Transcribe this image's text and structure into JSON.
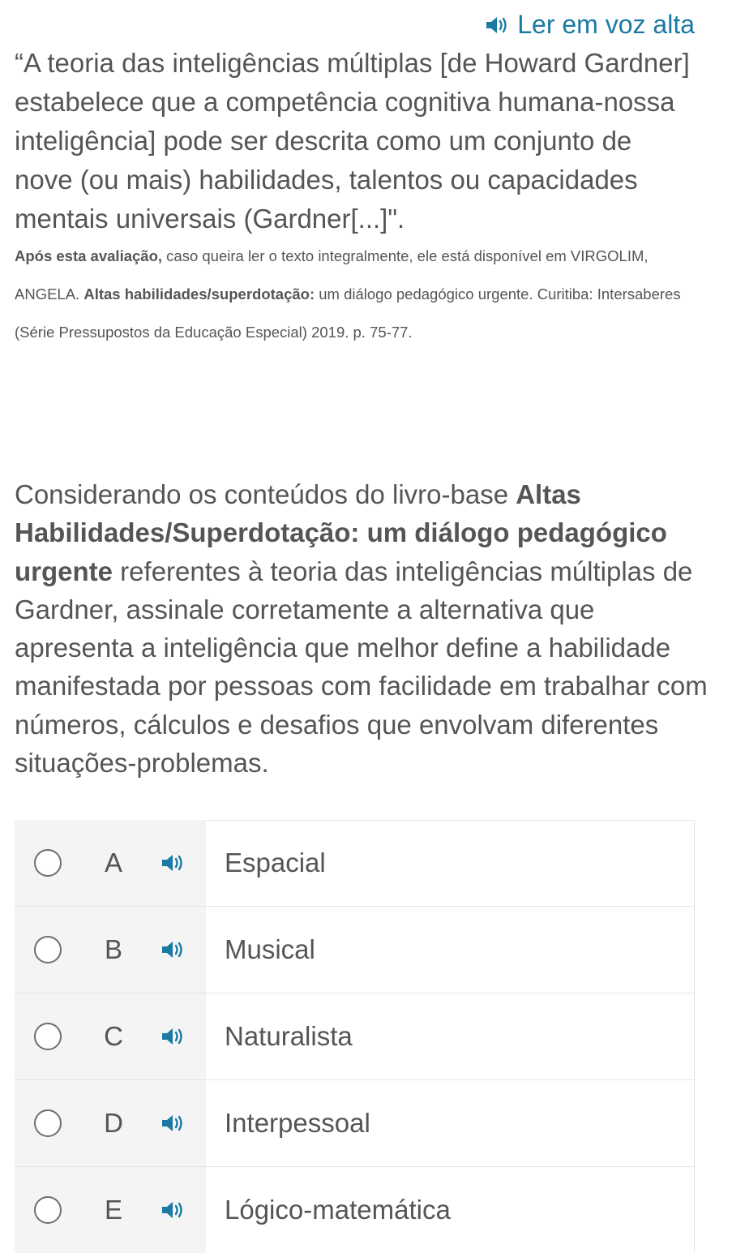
{
  "read_aloud": {
    "label": "Ler em voz alta",
    "color": "#1a7aa3",
    "icon": "speaker-icon"
  },
  "quote": {
    "lines": [
      "“A teoria das inteligências múltiplas [de Howard Gardner]",
      "estabelece que a competência cognitiva humana-nossa",
      "inteligência] pode ser descrita como um conjunto de",
      "nove (ou mais) habilidades, talentos ou capacidades",
      "mentais universais (Gardner[...]\"."
    ]
  },
  "reference": {
    "line1_bold": "Após esta avaliação,",
    "line1_rest": " caso queira ler o texto integralmente, ele está disponível em VIRGOLIM,",
    "line2_start": "ANGELA. ",
    "line2_bold": "Altas habilidades/superdotação:",
    "line2_rest": " um diálogo pedagógico urgente. Curitiba: Intersaberes",
    "line3": "(Série Pressupostos da Educação Especial) 2019. p. 75-77."
  },
  "question": {
    "part1": "Considerando os conteúdos do livro-base ",
    "bold": "Altas Habilidades/Superdotação: um diálogo pedagógico urgente",
    "part2": " referentes à teoria das inteligências múltiplas de Gardner, assinale corretamente a alternativa que apresenta a inteligência que melhor define a habilidade manifestada por pessoas com facilidade em trabalhar com números, cálculos e desafios que envolvam diferentes situações-problemas."
  },
  "options": [
    {
      "letter": "A",
      "text": "Espacial"
    },
    {
      "letter": "B",
      "text": "Musical"
    },
    {
      "letter": "C",
      "text": "Naturalista"
    },
    {
      "letter": "D",
      "text": "Interpessoal"
    },
    {
      "letter": "E",
      "text": "Lógico-matemática"
    }
  ]
}
